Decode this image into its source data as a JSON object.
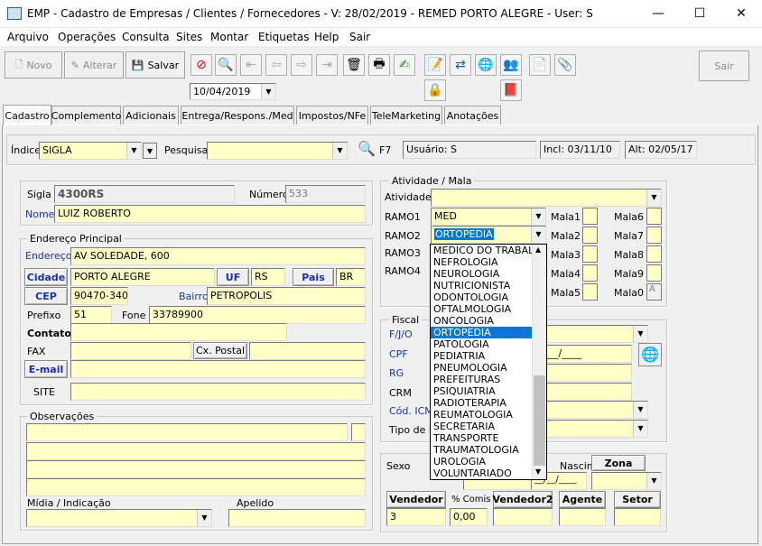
{
  "window": {
    "title": "EMP - Cadastro de Empresas / Clientes / Fornecedores  -  V: 28/02/2019 - REMED PORTO ALEGRE - User: S",
    "minimize": "—",
    "maximize": "☐",
    "close": "✕"
  },
  "menu": [
    "Arquivo",
    "Operações",
    "Consulta",
    "Sites",
    "Montar",
    "Etiquetas",
    "Help",
    "Sair"
  ],
  "toolbar": {
    "novo": "Novo",
    "alterar": "Alterar",
    "salvar": "Salvar",
    "sair": "Sair",
    "date": "10/04/2019"
  },
  "tabs": [
    "Cadastro",
    "Complemento",
    "Adicionais",
    "Entrega/Respons./Med",
    "Impostos/NFe",
    "TeleMarketing",
    "Anotações"
  ],
  "search": {
    "indice_label": "Índice",
    "indice_value": "SIGLA",
    "pesquisa_label": "Pesquisa",
    "pesquisa_value": "",
    "f7": "F7",
    "usuario": "Usuário: S",
    "incl": "Incl: 03/11/10",
    "alt": "Alt: 02/05/17"
  },
  "ident": {
    "sigla_label": "Sigla",
    "sigla": "4300RS",
    "numero_label": "Número",
    "numero": "533",
    "nome_label": "Nome",
    "nome": "LUIZ ROBERTO"
  },
  "endereco": {
    "group": "Endereço Principal",
    "endereco_label": "Endereço",
    "endereco": "AV SOLEDADE, 600",
    "cidade_btn": "Cidade",
    "cidade": "PORTO ALEGRE",
    "uf_btn": "UF",
    "uf": "RS",
    "pais_btn": "Pais",
    "pais": "BR",
    "cep_btn": "CEP",
    "cep": "90470-340",
    "bairro_label": "Bairro",
    "bairro": "PETROPOLIS",
    "prefixo_label": "Prefixo",
    "prefixo": "51",
    "fone_label": "Fone",
    "fone": "33789900",
    "contato_label": "Contato",
    "contato": "",
    "fax_label": "FAX",
    "fax": "",
    "cxpostal_label": "Cx. Postal",
    "cxpostal": "",
    "email_btn": "E-mail",
    "email": "",
    "site_label": "SITE",
    "site": ""
  },
  "obs": {
    "group": "Observações",
    "midia_label": "Mídia / Indicação",
    "apelido_label": "Apelido"
  },
  "atividade": {
    "group": "Atividade / Mala",
    "atividade_label": "Atividade",
    "ramo1_label": "RAMO1",
    "ramo1": "MED",
    "ramo2_label": "RAMO2",
    "ramo2": "ORTOPEDIA",
    "ramo3_label": "RAMO3",
    "ramo4_label": "RAMO4",
    "malas": [
      "Mala1",
      "Mala2",
      "Mala3",
      "Mala4",
      "Mala5",
      "Mala6",
      "Mala7",
      "Mala8",
      "Mala9",
      "Mala0"
    ],
    "mala0_value": "A"
  },
  "dropdown_list": [
    "MEDICO DO TRABALHO",
    "NEFROLOGIA",
    "NEUROLOGIA",
    "NUTRICIONISTA",
    "ODONTOLOGIA",
    "OFTALMOLOGIA",
    "ONCOLOGIA",
    "ORTOPEDIA",
    "PATOLOGIA",
    "PEDIATRIA",
    "PNEUMOLOGIA",
    "PREFEITURAS",
    "PSIQUIATRIA",
    "RADIOTERAPIA",
    "REUMATOLOGIA",
    "SECRETARIA",
    "TRANSPORTE",
    "TRAUMATOLOGIA",
    "UROLOGIA",
    "VOLUNTARIADO"
  ],
  "dropdown_selected": "ORTOPEDIA",
  "fiscal": {
    "group": "Fiscal",
    "fjo_label": "F/J/O",
    "cpf_label": "CPF",
    "cpf_mask": "___/____",
    "rg_label": "RG",
    "crm_label": "CRM",
    "codicm_label": "Cód. ICM",
    "tipo_label": "Tipo de E"
  },
  "bottom": {
    "sexo_label": "Sexo",
    "nasc_label": "Nascim.",
    "nasc_mask": "__/__/____",
    "zona_btn": "Zona",
    "vendedor_btn": "Vendedor",
    "vendedor": "3",
    "comis_label": "% Comis",
    "comis": "0,00",
    "vendedor2_btn": "Vendedor2",
    "agente_btn": "Agente",
    "setor_btn": "Setor"
  }
}
